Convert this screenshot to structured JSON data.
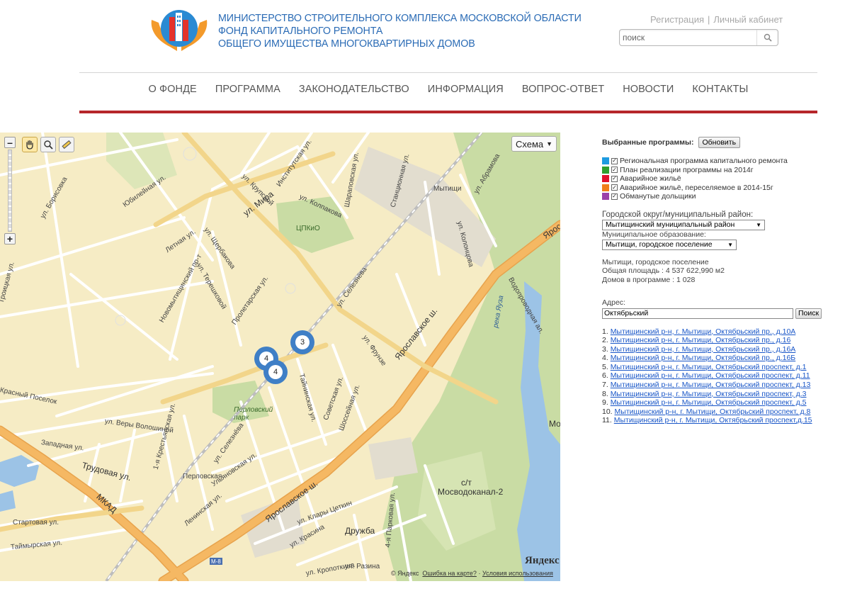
{
  "header": {
    "title_lines": [
      "МИНИСТЕРСТВО СТРОИТЕЛЬНОГО КОМПЛЕКСА МОСКОВСКОЙ ОБЛАСТИ",
      "ФОНД КАПИТАЛЬНОГО РЕМОНТА",
      "ОБЩЕГО ИМУЩЕСТВА МНОГОКВАРТИРНЫХ ДОМОВ"
    ],
    "link_register": "Регистрация",
    "link_separator": "|",
    "link_cabinet": "Личный кабинет",
    "search_placeholder": "поиск",
    "logo_icon": "hands-house-logo",
    "search_icon": "magnifier-icon"
  },
  "nav": {
    "items": [
      "О ФОНДЕ",
      "ПРОГРАММА",
      "ЗАКОНОДАТЕЛЬСТВО",
      "ИНФОРМАЦИЯ",
      "ВОПРОС-ОТВЕТ",
      "НОВОСТИ",
      "КОНТАКТЫ"
    ]
  },
  "map": {
    "scheme_label": "Схема",
    "zoom_in": "+",
    "zoom_out": "–",
    "clusters": [
      "3",
      "4",
      "4"
    ],
    "labels": {
      "mira": "ул. Мира",
      "yaroslavskoe": "Ярославское ш.",
      "yaroslavskoe2": "Ярославское ш.",
      "yarosl_right": "Яросл",
      "mkad": "МКАД",
      "trudovaya": "Трудовая ул.",
      "perlovsky_park": "Перловский парк",
      "perlovskaya": "Перловская",
      "mytishchi_st": "Мытищи",
      "tspkio": "ЦПКиО",
      "druzhba": "Дружба",
      "mosvodokanal": "Мосводоканал-2",
      "st": "с/т",
      "yauza": "река Яуза",
      "krasny_poselok": "Красный Поселок",
      "yubileynaya": "Юбилейная ул.",
      "letnyaya": "Летная ул.",
      "novomyt": "Новомытищинский пр-т",
      "shcherbakova": "ул. Щербакова",
      "tereshkovoy": "ул. Терешковой",
      "proletarskaya": "Пролетарская ул.",
      "seleznyova": "ул. Селезнёва",
      "seleznyova2": "ул. Селезнёва",
      "frunze": "ул. Фрунзе",
      "taininskaya": "Тайнинская ул.",
      "sovetskaya": "Советская ул.",
      "shosseynaya": "Шоссейная ул.",
      "veri_voloshinoy": "ул. Веры Волошиной",
      "zapadnaya": "Западная ул.",
      "krestyanskaya": "1-я Крестьянская ул.",
      "leninskaya": "Ленинская ул.",
      "ulyanovskaya": "Ульяновская ул.",
      "klary": "ул. Клары Цеткин",
      "krasina": "ул. Красина",
      "razina": "ул. Разина",
      "kropotkina": "ул. Кропоткина",
      "parkovaya": "4-я Парковая ул.",
      "startovaya": "Стартовая ул.",
      "taimyrskaya": "Таймырская ул.",
      "kolontsova": "ул. Колонцова",
      "abramova": "ул. Абрамова",
      "vodoprovodnaya": "Водопроводная ал.",
      "stantsionnaya": "Станционная ул.",
      "sharapovskaya": "Шараповская ул.",
      "kolpakova": "ул. Колпакова",
      "institutskaya": "Институтская ул.",
      "krupskoy": "ул. Крупской",
      "troitskaya": "Троицкая ул.",
      "borisovka": "ул. Борисовка",
      "mo_right": "Мо",
      "m8": "М-8"
    },
    "yandex_logo": "Яндекс",
    "footer_copy": "© Яндекс",
    "footer_error": "Ошибка на карте?",
    "footer_dot": "·",
    "footer_terms": "Условия использования",
    "colors": {
      "base": "#f6ecc5",
      "road_major": "#f5b863",
      "road_minor": "#ffffff",
      "park": "#c9dca4",
      "water": "#9cc3e6",
      "cluster": "#3f7fc6"
    }
  },
  "panel": {
    "programs_title": "Выбранные программы:",
    "refresh_button": "Обновить",
    "programs": [
      {
        "label": "Региональная программа капитального ремонта",
        "color": "#1e9be0"
      },
      {
        "label": "План реализации программы на 2014г",
        "color": "#2f9f2f"
      },
      {
        "label": "Аварийное жильё",
        "color": "#e0102c"
      },
      {
        "label": "Аварийное жильё, переселяемое в 2014-15г",
        "color": "#f07e1a"
      },
      {
        "label": "Обманутые дольщики",
        "color": "#9b3fa8"
      }
    ],
    "district_label": "Городской округ/муниципальный район:",
    "district_value": "Мытищинский муниципальный район",
    "municipality_label": "Муниципальное образование:",
    "municipality_value": "Мытищи, городское поселение",
    "info_name": "Мытищи, городское поселение",
    "info_area": "Общая площадь : 4 537 622,990 м2",
    "info_houses": "Домов в программе : 1 028",
    "address_label": "Адрес:",
    "address_value": "Октябрьский",
    "address_search": "Поиск",
    "results": [
      {
        "num": "1.",
        "text": "Мытищинский р-н, г. Мытищи, Октябрьский пр., д.10А"
      },
      {
        "num": "2.",
        "text": "Мытищинский р-н, г. Мытищи, Октябрьский пр., д.16"
      },
      {
        "num": "3.",
        "text": "Мытищинский р-н, г. Мытищи, Октябрьский пр., д.16А"
      },
      {
        "num": "4.",
        "text": "Мытищинский р-н, г. Мытищи, Октябрьский пр., д.16Б"
      },
      {
        "num": "5.",
        "text": "Мытищинский р-н, г. Мытищи, Октябрьский проспект, д.1"
      },
      {
        "num": "6.",
        "text": "Мытищинский р-н, г. Мытищи, Октябрьский проспект, д.11"
      },
      {
        "num": "7.",
        "text": "Мытищинский р-н, г. Мытищи, Октябрьский проспект, д.13"
      },
      {
        "num": "8.",
        "text": "Мытищинский р-н, г. Мытищи, Октябрьский проспект, д.3"
      },
      {
        "num": "9.",
        "text": "Мытищинский р-н, г. Мытищи, Октябрьский проспект, д.5"
      },
      {
        "num": "10.",
        "text": "Мытищинский р-н, г. Мытищи, Октябрьский проспект, д.8"
      },
      {
        "num": "11.",
        "text": "Мытищинский р-н, г. Мытищи, Октябрьский проспект,д.15"
      }
    ]
  }
}
